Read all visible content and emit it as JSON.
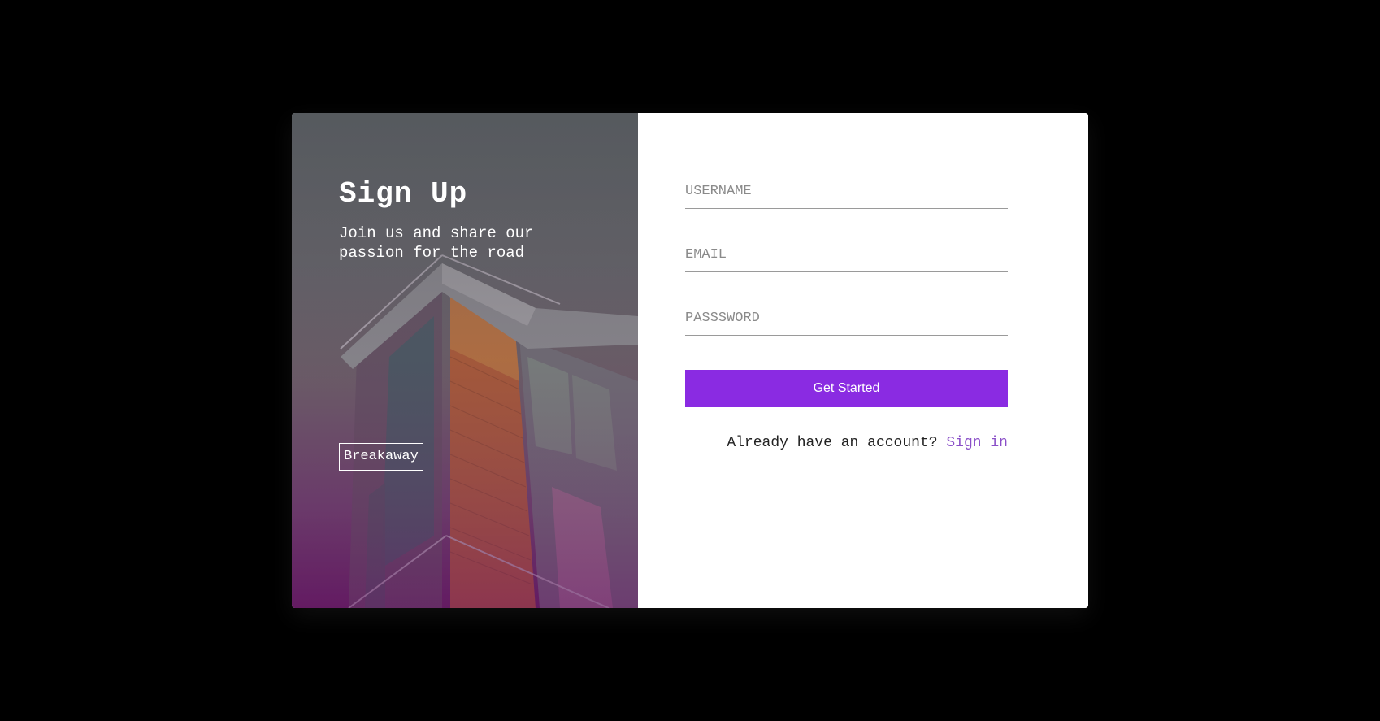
{
  "hero": {
    "title": "Sign Up",
    "subtitle": "Join us and share our passion for the road",
    "brand": "Breakaway"
  },
  "form": {
    "username_placeholder": "USERNAME",
    "email_placeholder": "EMAIL",
    "password_placeholder": "PASSSWORD",
    "submit_label": "Get Started",
    "signin_prompt": "Already have an account?",
    "signin_link": "Sign in"
  },
  "colors": {
    "background": "#000000",
    "accent": "#8a2be2",
    "link": "#8a4fc8",
    "card": "#ffffff"
  }
}
